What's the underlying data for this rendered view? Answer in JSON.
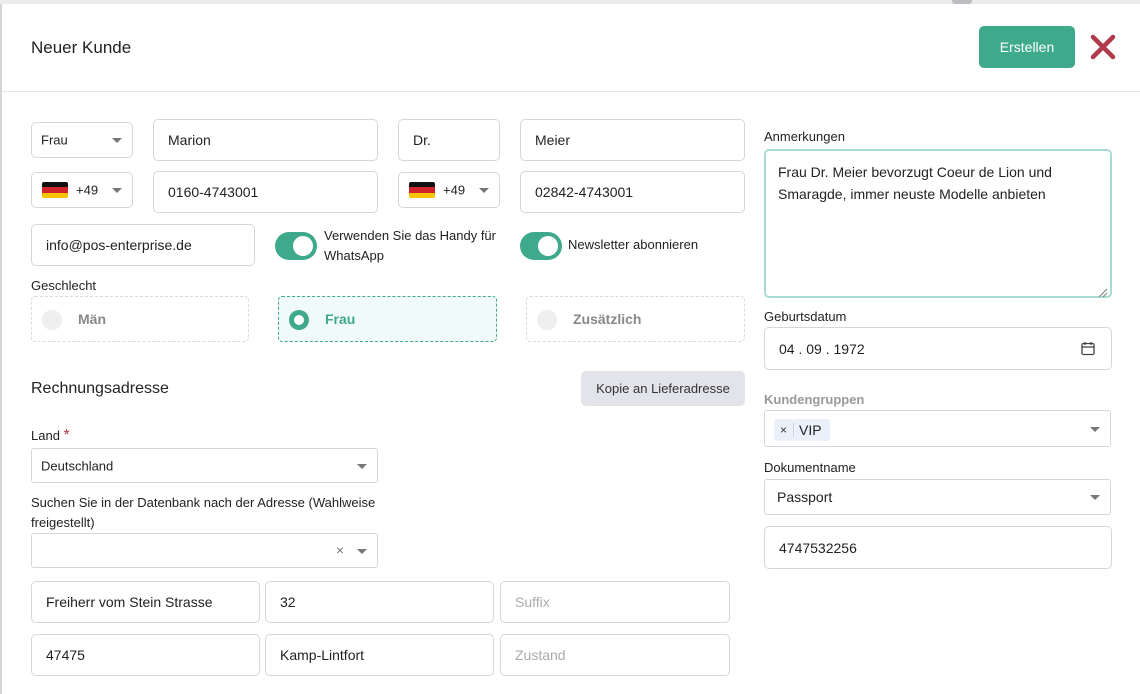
{
  "header": {
    "title": "Neuer Kunde",
    "create_label": "Erstellen",
    "close_color": "#b03a4b"
  },
  "person": {
    "salutation": "Frau",
    "first_name": "Marion",
    "title": "Dr.",
    "last_name": "Meier",
    "mobile_prefix": "+49",
    "mobile": "0160-4743001",
    "phone_prefix": "+49",
    "phone": "02842-4743001",
    "email": "info@pos-enterprise.de"
  },
  "toggles": {
    "whatsapp_label": "Verwenden Sie das Handy für WhatsApp",
    "whatsapp_on": true,
    "newsletter_label": "Newsletter abonnieren",
    "newsletter_on": true
  },
  "gender": {
    "label": "Geschlecht",
    "options": [
      "Män",
      "Frau",
      "Zusätzlich"
    ],
    "selected": "Frau"
  },
  "billing": {
    "heading": "Rechnungsadresse",
    "copy_label": "Kopie an Lieferadresse",
    "country_label": "Land",
    "country_required": "*",
    "country": "Deutschland",
    "search_label": "Suchen Sie in der Datenbank nach der Adresse (Wahlweise freigestellt)",
    "search_clear": "×",
    "street": "Freiherr vom Stein Strasse",
    "number": "32",
    "suffix_placeholder": "Suffix",
    "zip": "47475",
    "city": "Kamp-Lintfort",
    "state_placeholder": "Zustand"
  },
  "right": {
    "notes_label": "Anmerkungen",
    "notes": "Frau Dr. Meier bevorzugt Coeur de Lion und Smaragde, immer neuste Modelle anbieten",
    "birthday_label": "Geburtsdatum",
    "birthday": "04 . 09 . 1972",
    "groups_label": "Kundengruppen",
    "group_chip_remove": "×",
    "group_chip": "VIP",
    "document_label": "Dokumentname",
    "document": "Passport",
    "document_number": "4747532256"
  },
  "colors": {
    "accent": "#3fa98b",
    "close": "#b03a4b"
  }
}
